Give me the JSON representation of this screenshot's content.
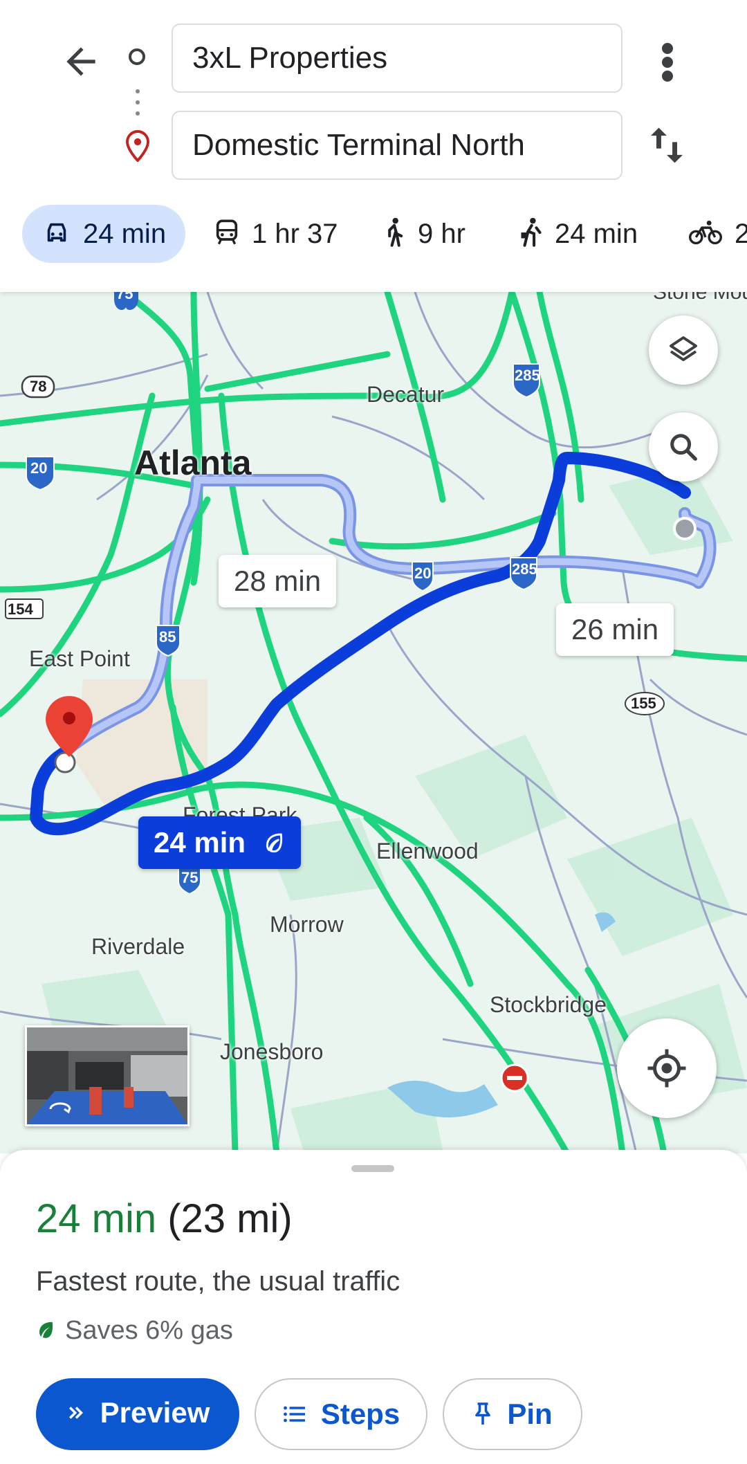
{
  "search": {
    "origin": "3xL Properties",
    "destination": "Domestic Terminal North"
  },
  "modes": [
    {
      "icon": "car-icon",
      "label": "24 min"
    },
    {
      "icon": "transit-icon",
      "label": "1 hr 37"
    },
    {
      "icon": "walk-icon",
      "label": "9 hr"
    },
    {
      "icon": "rideshare-icon",
      "label": "24 min"
    },
    {
      "icon": "bike-icon",
      "label": "2"
    }
  ],
  "map": {
    "cities": {
      "atlanta": "Atlanta"
    },
    "labels": {
      "decatur": "Decatur",
      "east_point": "East Point",
      "forest_park": "Forest Park",
      "ellenwood": "Ellenwood",
      "morrow": "Morrow",
      "riverdale": "Riverdale",
      "stockbridge": "Stockbridge",
      "jonesboro": "Jonesboro",
      "stone_mountain": "Stone Mountain"
    },
    "shields": {
      "i75_top": "75",
      "us78": "78",
      "i20_west": "20",
      "i285_ne": "285",
      "sr154": "154",
      "i85": "85",
      "i20_east": "20",
      "i285_east": "285",
      "sr155": "155",
      "i75_south": "75"
    },
    "route_times": {
      "alt1": "28 min",
      "alt2": "26 min",
      "main": "24 min"
    },
    "colors": {
      "route_main": "#0b3ddb",
      "route_alt": "#a6b9f2",
      "traffic": "#1ed47e",
      "destination": "#ea4335"
    }
  },
  "summary": {
    "duration": "24 min",
    "distance": "(23 mi)",
    "description": "Fastest route, the usual traffic",
    "savings": "Saves 6% gas"
  },
  "actions": {
    "preview": "Preview",
    "steps": "Steps",
    "pin": "Pin"
  }
}
